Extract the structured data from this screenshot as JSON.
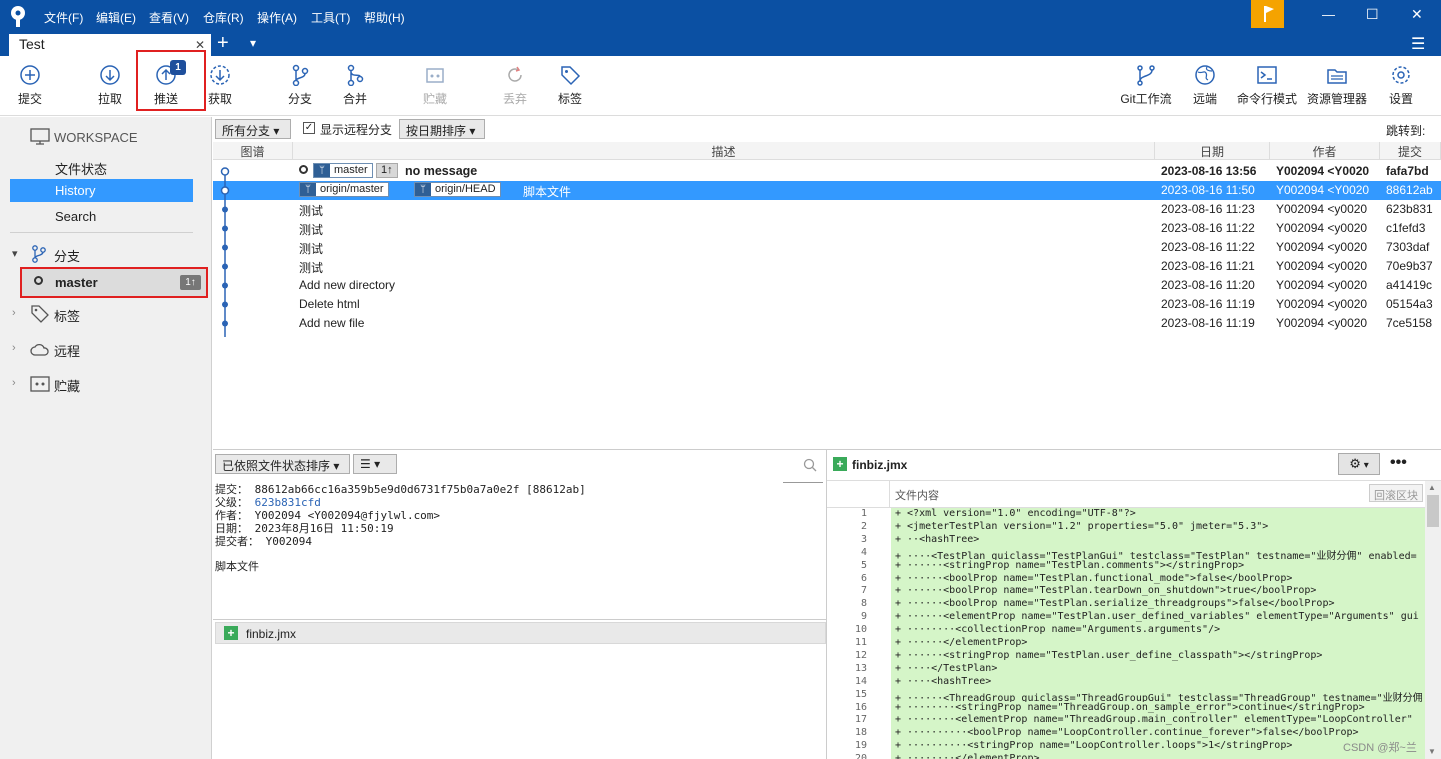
{
  "menu": [
    "文件(F)",
    "编辑(E)",
    "查看(V)",
    "仓库(R)",
    "操作(A)",
    "工具(T)",
    "帮助(H)"
  ],
  "window_controls": {
    "minimize": "—",
    "maximize": "☐",
    "close": "✕"
  },
  "tab": {
    "title": "Test",
    "close": "✕",
    "add": "+",
    "dropdown": "▾",
    "menu_icon": "☰"
  },
  "toolbar": {
    "commit": "提交",
    "pull": "拉取",
    "push": "推送",
    "push_badge": "1",
    "fetch": "获取",
    "branch": "分支",
    "merge": "合并",
    "stash": "贮藏",
    "discard": "丢弃",
    "tag": "标签",
    "gitflow": "Git工作流",
    "remote": "远端",
    "terminal": "命令行模式",
    "explorer": "资源管理器",
    "settings": "设置"
  },
  "sidebar": {
    "workspace": "WORKSPACE",
    "file_status": "文件状态",
    "history": "History",
    "search": "Search",
    "branches": "分支",
    "master": "master",
    "master_badge": "1↑",
    "tags": "标签",
    "remotes": "远程",
    "stashes": "贮藏"
  },
  "filters": {
    "branches": "所有分支 ▾",
    "show_remote": "显示远程分支",
    "sort": "按日期排序 ▾",
    "jump_to": "跳转到:"
  },
  "columns": {
    "graph": "图谱",
    "description": "描述",
    "date": "日期",
    "author": "作者",
    "commit": "提交"
  },
  "commits": [
    {
      "refs": [
        "master",
        "1↑"
      ],
      "desc": "no message",
      "date": "2023-08-16 13:56",
      "author": "Y002094 <Y0020",
      "hash": "fafa7bd"
    },
    {
      "refs": [
        "origin/master",
        "origin/HEAD"
      ],
      "desc": "脚本文件",
      "date": "2023-08-16 11:50",
      "author": "Y002094 <Y0020",
      "hash": "88612ab"
    },
    {
      "desc": "测试",
      "date": "2023-08-16 11:23",
      "author": "Y002094 <y0020",
      "hash": "623b831"
    },
    {
      "desc": "测试",
      "date": "2023-08-16 11:22",
      "author": "Y002094 <y0020",
      "hash": "c1fefd3"
    },
    {
      "desc": "测试",
      "date": "2023-08-16 11:22",
      "author": "Y002094 <y0020",
      "hash": "7303daf"
    },
    {
      "desc": "测试",
      "date": "2023-08-16 11:21",
      "author": "Y002094 <y0020",
      "hash": "70e9b37"
    },
    {
      "desc": "Add new directory",
      "date": "2023-08-16 11:20",
      "author": "Y002094 <y0020",
      "hash": "a41419c"
    },
    {
      "desc": "Delete html",
      "date": "2023-08-16 11:19",
      "author": "Y002094 <y0020",
      "hash": "05154a3"
    },
    {
      "desc": "Add new file",
      "date": "2023-08-16 11:19",
      "author": "Y002094 <y0020",
      "hash": "7ce5158"
    }
  ],
  "details": {
    "sort": "已依照文件状态排序 ▾",
    "view_toggle": "☰ ▾",
    "commit_line": "提交： 88612ab66cc16a359b5e9d0d6731f75b0a7a0e2f [88612ab]",
    "parent_label": "父级：",
    "parent": "623b831cfd",
    "author_line": "作者： Y002094 <Y002094@fjylwl.com>",
    "date_line": "日期： 2023年8月16日 11:50:19",
    "committer_line": "提交者： Y002094",
    "message": "脚本文件",
    "file": "finbiz.jmx"
  },
  "diff": {
    "file": "finbiz.jmx",
    "header": "文件内容",
    "revert": "回滚区块",
    "lines": [
      {
        "n": "1",
        "t": "+ <?xml version=\"1.0\" encoding=\"UTF-8\"?>"
      },
      {
        "n": "2",
        "t": "+ <jmeterTestPlan version=\"1.2\" properties=\"5.0\" jmeter=\"5.3\">"
      },
      {
        "n": "3",
        "t": "+ ··<hashTree>"
      },
      {
        "n": "4",
        "t": "+ ····<TestPlan guiclass=\"TestPlanGui\" testclass=\"TestPlan\" testname=\"业财分佣\" enabled="
      },
      {
        "n": "5",
        "t": "+ ······<stringProp name=\"TestPlan.comments\"></stringProp>"
      },
      {
        "n": "6",
        "t": "+ ······<boolProp name=\"TestPlan.functional_mode\">false</boolProp>"
      },
      {
        "n": "7",
        "t": "+ ······<boolProp name=\"TestPlan.tearDown_on_shutdown\">true</boolProp>"
      },
      {
        "n": "8",
        "t": "+ ······<boolProp name=\"TestPlan.serialize_threadgroups\">false</boolProp>"
      },
      {
        "n": "9",
        "t": "+ ······<elementProp name=\"TestPlan.user_defined_variables\" elementType=\"Arguments\" gui"
      },
      {
        "n": "10",
        "t": "+ ········<collectionProp name=\"Arguments.arguments\"/>"
      },
      {
        "n": "11",
        "t": "+ ······</elementProp>"
      },
      {
        "n": "12",
        "t": "+ ······<stringProp name=\"TestPlan.user_define_classpath\"></stringProp>"
      },
      {
        "n": "13",
        "t": "+ ····</TestPlan>"
      },
      {
        "n": "14",
        "t": "+ ····<hashTree>"
      },
      {
        "n": "15",
        "t": "+ ······<ThreadGroup guiclass=\"ThreadGroupGui\" testclass=\"ThreadGroup\" testname=\"业财分佣"
      },
      {
        "n": "16",
        "t": "+ ········<stringProp name=\"ThreadGroup.on_sample_error\">continue</stringProp>"
      },
      {
        "n": "17",
        "t": "+ ········<elementProp name=\"ThreadGroup.main_controller\" elementType=\"LoopController\" "
      },
      {
        "n": "18",
        "t": "+ ··········<boolProp name=\"LoopController.continue_forever\">false</boolProp>"
      },
      {
        "n": "19",
        "t": "+ ··········<stringProp name=\"LoopController.loops\">1</stringProp>"
      },
      {
        "n": "20",
        "t": "+ ········</elementProp>"
      }
    ]
  },
  "watermark": "CSDN @郑~兰",
  "colors": {
    "titlebar": "#0b50a3",
    "selection": "#3399ff",
    "highlight_box": "#e02020",
    "added_line": "#d5f5c8",
    "flag": "#f5a300"
  }
}
